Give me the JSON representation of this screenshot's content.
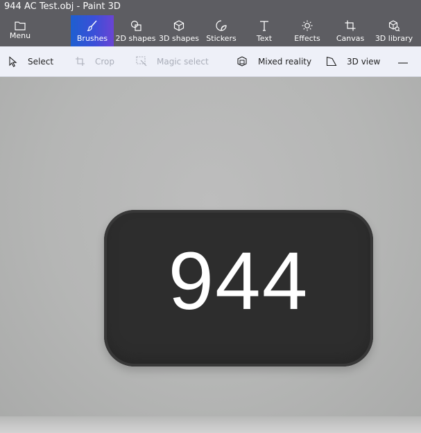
{
  "window": {
    "title": "944 AC Test.obj - Paint 3D"
  },
  "ribbon": {
    "menu_label": "Menu",
    "items": [
      {
        "label": "Brushes",
        "icon": "brush-icon",
        "active": true
      },
      {
        "label": "2D shapes",
        "icon": "2d-shapes-icon"
      },
      {
        "label": "3D shapes",
        "icon": "3d-shapes-icon"
      },
      {
        "label": "Stickers",
        "icon": "stickers-icon"
      },
      {
        "label": "Text",
        "icon": "text-icon"
      },
      {
        "label": "Effects",
        "icon": "effects-icon"
      },
      {
        "label": "Canvas",
        "icon": "canvas-icon"
      },
      {
        "label": "3D library",
        "icon": "3d-library-icon"
      }
    ]
  },
  "toolbar": {
    "select": "Select",
    "crop": "Crop",
    "magic_select": "Magic select",
    "mixed_reality": "Mixed reality",
    "view_3d": "3D view"
  },
  "canvas": {
    "object_text": "944"
  },
  "colors": {
    "chrome": "#5d5d62",
    "active_start": "#1e5fd0",
    "active_end": "#6a44d4",
    "toolbar_bg": "#eef0f8",
    "object": "#2d2d2d"
  }
}
